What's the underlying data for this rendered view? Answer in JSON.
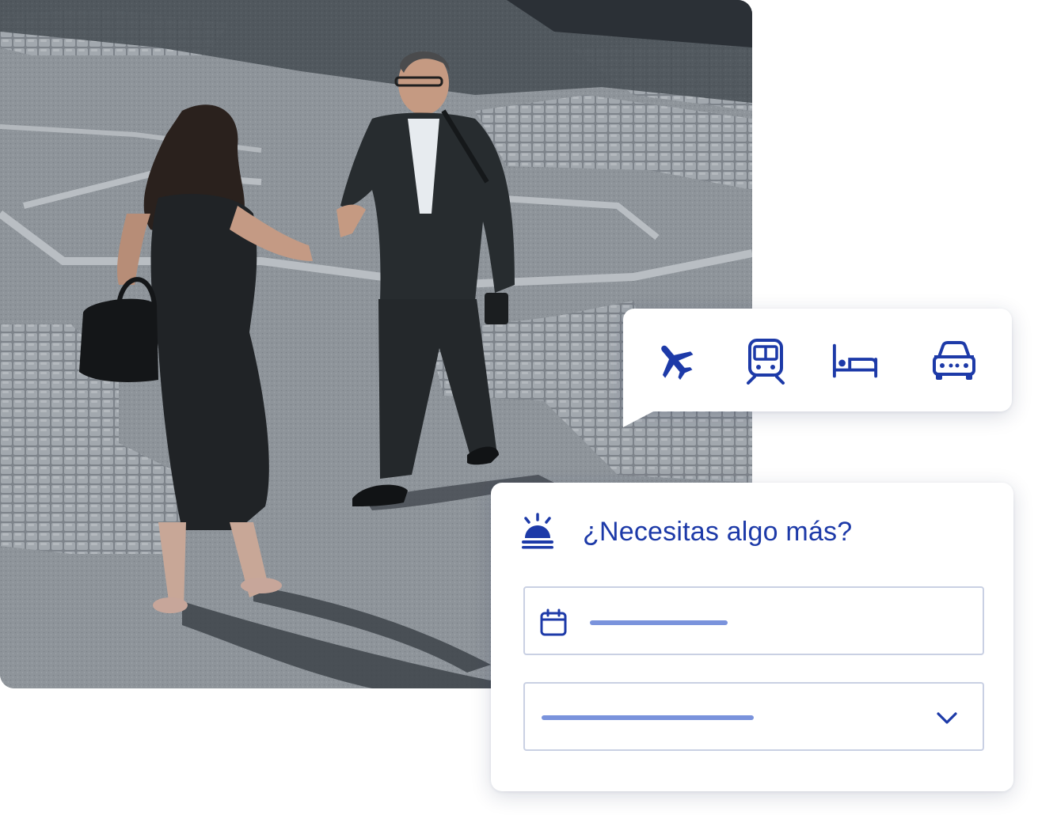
{
  "photo": {
    "alt": "Dos personas de negocios saludándose con un apretón de manos en una plaza"
  },
  "travel_types": [
    {
      "name": "flight",
      "icon": "airplane-icon"
    },
    {
      "name": "train",
      "icon": "train-icon"
    },
    {
      "name": "hotel",
      "icon": "bed-icon"
    },
    {
      "name": "car",
      "icon": "car-icon"
    }
  ],
  "request": {
    "title": "¿Necesitas algo más?",
    "icon": "service-bell-icon",
    "date_field": {
      "icon": "calendar-icon"
    },
    "select_field": {
      "icon": "chevron-down-icon"
    }
  },
  "colors": {
    "accent": "#1d3aa8",
    "placeholder": "#7a93dc",
    "field_border": "#c9d0e3"
  }
}
